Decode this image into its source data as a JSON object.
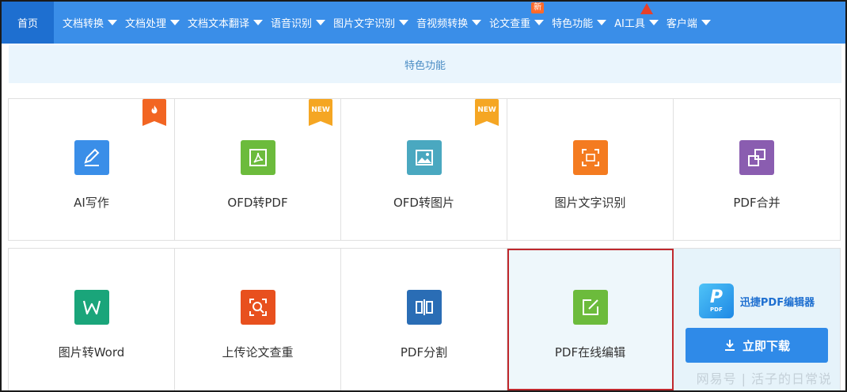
{
  "nav": {
    "items": [
      {
        "label": "首页"
      },
      {
        "label": "文档转换"
      },
      {
        "label": "文档处理"
      },
      {
        "label": "文档文本翻译"
      },
      {
        "label": "语音识别"
      },
      {
        "label": "图片文字识别"
      },
      {
        "label": "音视频转换"
      },
      {
        "label": "论文查重"
      },
      {
        "label": "特色功能"
      },
      {
        "label": "AI工具"
      },
      {
        "label": "客户端"
      }
    ],
    "new_badge": "新"
  },
  "banner": {
    "title": "特色功能"
  },
  "features": [
    {
      "label": "AI写作",
      "color": "#3a8ee8",
      "icon": "pen-icon",
      "tag": "fire"
    },
    {
      "label": "OFD转PDF",
      "color": "#6cbb3c",
      "icon": "pdf-icon",
      "tag": "NEW"
    },
    {
      "label": "OFD转图片",
      "color": "#4aa8c0",
      "icon": "image-icon",
      "tag": "NEW"
    },
    {
      "label": "图片文字识别",
      "color": "#f47b20",
      "icon": "scan-icon",
      "tag": ""
    },
    {
      "label": "PDF合并",
      "color": "#8a5db0",
      "icon": "merge-icon",
      "tag": ""
    },
    {
      "label": "图片转Word",
      "color": "#1aa57a",
      "icon": "word-icon",
      "tag": ""
    },
    {
      "label": "上传论文查重",
      "color": "#e8501e",
      "icon": "check-icon",
      "tag": ""
    },
    {
      "label": "PDF分割",
      "color": "#2a6db5",
      "icon": "split-icon",
      "tag": ""
    },
    {
      "label": "PDF在线编辑",
      "color": "#6cbb3c",
      "icon": "edit-icon",
      "tag": ""
    }
  ],
  "tag_new_text": "NEW",
  "promo": {
    "logo_letter": "P",
    "logo_sub": "PDF",
    "title": "迅捷PDF编辑器",
    "download_label": "立即下载"
  },
  "watermark": {
    "left": "网易号",
    "sep": "|",
    "right": "活子的日常说"
  }
}
